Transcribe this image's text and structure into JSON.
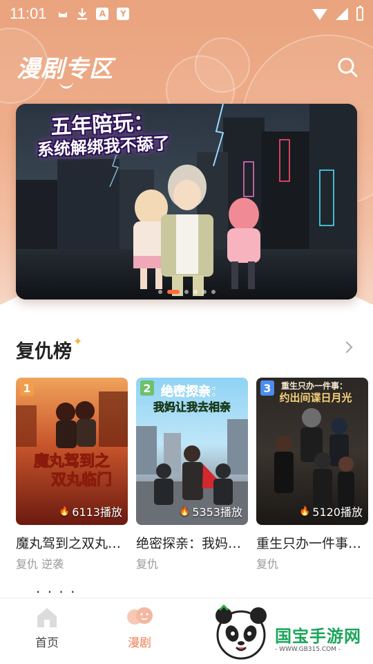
{
  "status_bar": {
    "time": "11:01",
    "icons": [
      "cat-icon",
      "download-icon",
      "a-icon",
      "y-icon",
      "wifi-icon",
      "signal-icon",
      "battery-icon"
    ]
  },
  "header": {
    "title": "漫剧专区",
    "search_icon": "search-icon"
  },
  "banner": {
    "line1": "五年陪玩：",
    "line2": "系统解绑我不舔了",
    "slide_count": 6,
    "active_index": 1
  },
  "section": {
    "title": "复仇榜",
    "more_icon": "chevron-right-icon"
  },
  "cards": [
    {
      "rank": "1",
      "rank_color": "#f29d4b",
      "cover_text": "魔丸驾到之双丸临门",
      "plays": "6113播放",
      "title": "魔丸驾到之双丸临门",
      "tags": "复仇 逆袭"
    },
    {
      "rank": "2",
      "rank_color": "#6fc06b",
      "cover_text": "绝密探亲：我妈让我去相亲",
      "plays": "5353播放",
      "title": "绝密探亲：我妈让我去相亲",
      "tags": "复仇"
    },
    {
      "rank": "3",
      "rank_color": "#4a8df0",
      "cover_text": "重生只办一件事：约出间谍日月光",
      "plays": "5120播放",
      "title": "重生只办一件事：约出间谍日月光",
      "tags": "复仇"
    }
  ],
  "next_section_peek": "· · · ·",
  "bottom_nav": [
    {
      "label": "首页",
      "icon": "home-icon",
      "active": false
    },
    {
      "label": "漫剧",
      "icon": "drama-icon",
      "active": true
    }
  ],
  "watermark": {
    "brand": "国宝手游网",
    "url": "- WWW.GB315.COM -"
  },
  "colors": {
    "accent": "#ef7b50",
    "header": "#e9a37e"
  }
}
